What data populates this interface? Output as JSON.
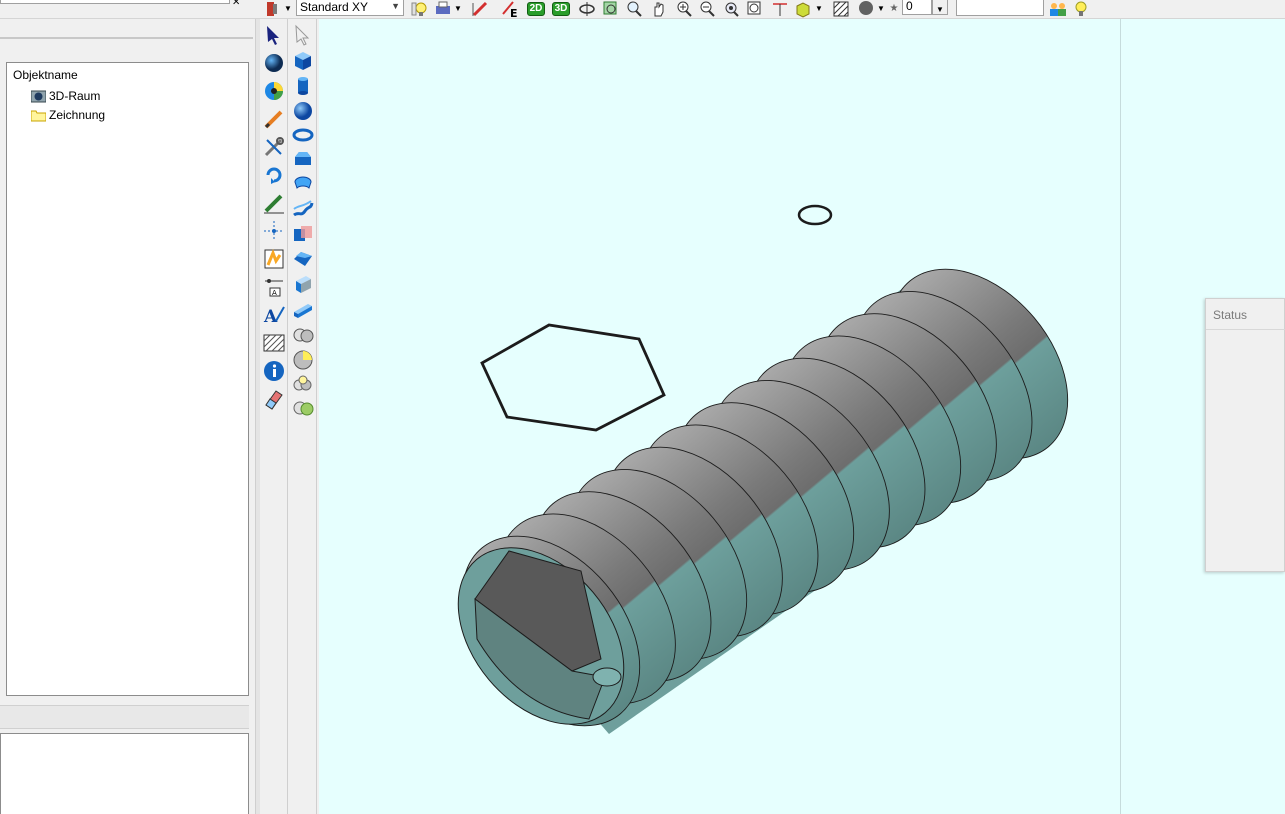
{
  "toolbar": {
    "view_select": {
      "value": "Standard XY"
    },
    "badge_2d": "2D",
    "badge_3d": "3D",
    "badge_e": "E",
    "layer_value": "0",
    "command_value": "",
    "icons": [
      "layer-icon",
      "bulb-icon",
      "print-icon",
      "pencil-icon",
      "export-icon",
      "view-2d-icon",
      "view-3d-icon",
      "rotate-icon",
      "zoom-frame-icon",
      "zoom-window-icon",
      "pan-icon",
      "zoom-in-icon",
      "zoom-out-icon",
      "zoom-all-icon",
      "zoom-prev-icon",
      "dimension-icon",
      "material-icon",
      "hatch-icon",
      "sphere-icon",
      "star-icon",
      "user-icon",
      "lightbulb-icon"
    ]
  },
  "tree": {
    "header": "Objektname",
    "items": [
      {
        "label": "3D-Raum",
        "icon": "3d-space-icon"
      },
      {
        "label": "Zeichnung",
        "icon": "folder-icon"
      }
    ]
  },
  "palette_a": {
    "tools": [
      "select-arrow-icon",
      "sphere-object-icon",
      "color-wheel-icon",
      "pencil-draw-icon",
      "wrench-icon",
      "rotate-copy-icon",
      "green-pencil-icon",
      "crosshair-icon",
      "snap-icon",
      "dimension-tool-icon",
      "text-tool-icon",
      "hatch-tool-icon",
      "info-icon",
      "eraser-icon"
    ]
  },
  "palette_b": {
    "tools": [
      "select-ghost-icon",
      "cube-icon",
      "cylinder-icon",
      "ball-icon",
      "torus-icon",
      "prism-icon",
      "ring-icon",
      "spiral-icon",
      "boolean-icon",
      "chamfer-icon",
      "extrude-icon",
      "slab-icon",
      "sphere-pair-icon",
      "sphere-yellow-icon",
      "sphere-triple-icon",
      "sphere-green-icon"
    ]
  },
  "status": {
    "title": "Status"
  },
  "colors": {
    "viewport_bg": "#e6fffe",
    "thread_top": "#7d7d7d",
    "thread_bottom": "#6b9f9c",
    "outline": "#1c1c1c"
  }
}
